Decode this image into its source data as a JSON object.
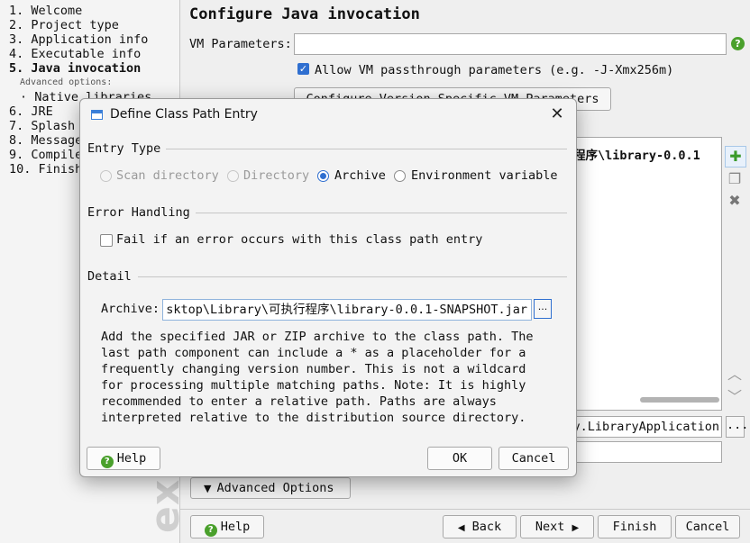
{
  "sidebar": {
    "steps": [
      "1. Welcome",
      "2. Project type",
      "3. Application info",
      "4. Executable info",
      "5. Java invocation",
      "6. JRE",
      "7. Splash",
      "8. Messages",
      "9. Compiler",
      "10. Finish"
    ],
    "advanced_label": "Advanced options:",
    "sub_item": "Native libraries",
    "watermark": "exe"
  },
  "main": {
    "title": "Configure Java invocation",
    "vm_label": "VM Parameters:",
    "vm_value": "",
    "passthrough_label": "Allow VM passthrough parameters (e.g. -J-Xmx256m)",
    "config_button": "Configure Version-Specific VM Parameters",
    "classpath_entry": "程序\\library-0.0.1",
    "main_class_value": "y.LibraryApplication",
    "browse_label": "...",
    "advanced_options_label": "Advanced Options",
    "help_label": "Help",
    "back_label": "Back",
    "next_label": "Next",
    "finish_label": "Finish",
    "cancel_label": "Cancel"
  },
  "dialog": {
    "title": "Define Class Path Entry",
    "entry_type_title": "Entry Type",
    "entry_types": {
      "scan": "Scan directory",
      "directory": "Directory",
      "archive": "Archive",
      "env": "Environment variable"
    },
    "selected_entry_type": "Archive",
    "error_title": "Error Handling",
    "fail_label": "Fail if an error occurs with this class path entry",
    "detail_title": "Detail",
    "archive_label": "Archive:",
    "archive_value": "sktop\\Library\\可执行程序\\library-0.0.1-SNAPSHOT.jar",
    "browse_label": "...",
    "description": "Add the specified JAR or ZIP archive to the class path. The\nlast path component can include a * as a placeholder for a\nfrequently changing version number. This is not a wildcard\nfor processing multiple matching paths. Note: It is highly\nrecommended to enter a relative path. Paths are always\ninterpreted relative to the distribution source directory.",
    "help_label": "Help",
    "ok_label": "OK",
    "cancel_label": "Cancel"
  },
  "colors": {
    "accent": "#2f6fd0",
    "help_green": "#4aa02c"
  }
}
